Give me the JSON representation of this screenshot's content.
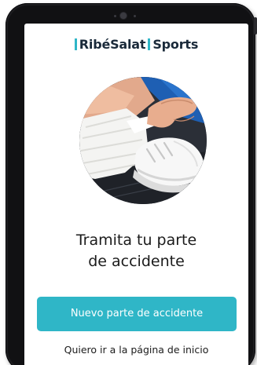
{
  "brand": {
    "name_part1": "RibéSalat",
    "name_part2": "Sports",
    "accent_color": "#2fb6c7"
  },
  "hero": {
    "image": "ankle-bandage-photo"
  },
  "main": {
    "headline_line1": "Tramita tu parte",
    "headline_line2": "de accidente"
  },
  "actions": {
    "primary_label": "Nuevo parte de accidente",
    "secondary_label": "Quiero ir a la página de inicio"
  }
}
